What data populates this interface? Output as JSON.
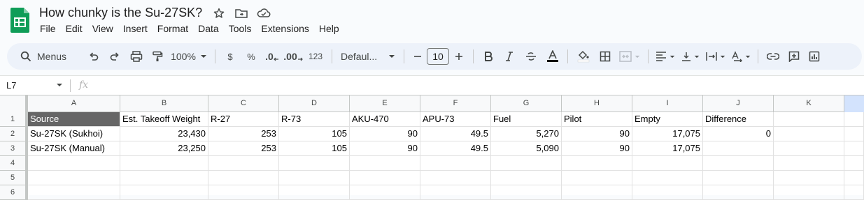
{
  "doc": {
    "title": "How chunky is the Su-27SK?"
  },
  "menu": [
    "File",
    "Edit",
    "View",
    "Insert",
    "Format",
    "Data",
    "Tools",
    "Extensions",
    "Help"
  ],
  "toolbar": {
    "search_label": "Menus",
    "zoom": "100%",
    "currency": "$",
    "percent": "%",
    "dec_decrease": ".0",
    "dec_increase": ".00",
    "number_format": "123",
    "font": "Defaul...",
    "font_size": "10"
  },
  "formula": {
    "cell_ref": "L7",
    "fx": "fx"
  },
  "columns": [
    "A",
    "B",
    "C",
    "D",
    "E",
    "F",
    "G",
    "H",
    "I",
    "J",
    "K"
  ],
  "rows": [
    "1",
    "2",
    "3",
    "4",
    "5",
    "6"
  ],
  "table": {
    "r1": [
      "Source",
      "Est. Takeoff Weight",
      "R-27",
      "R-73",
      "AKU-470",
      "APU-73",
      "Fuel",
      "Pilot",
      "Empty",
      "Difference",
      ""
    ],
    "r2": [
      "Su-27SK (Sukhoi)",
      "23,430",
      "253",
      "105",
      "90",
      "49.5",
      "5,270",
      "90",
      "17,075",
      "0",
      ""
    ],
    "r3": [
      "Su-27SK (Manual)",
      "23,250",
      "253",
      "105",
      "90",
      "49.5",
      "5,090",
      "90",
      "17,075",
      "",
      ""
    ]
  },
  "colors": {
    "sheets_green": "#0f9d58",
    "header_fill": "#666666",
    "selected_col": "#d3e3fd"
  }
}
